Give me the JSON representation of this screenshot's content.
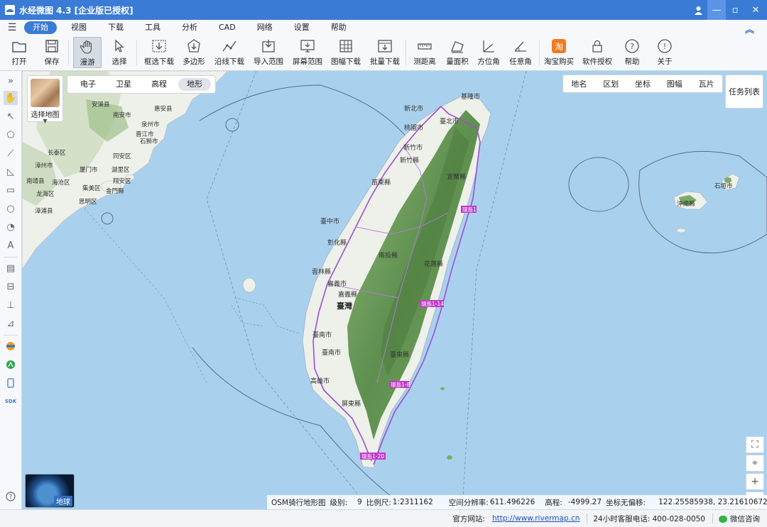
{
  "window": {
    "title": "水经微图 4.3 [企业版已授权]"
  },
  "menu": {
    "items": [
      "开始",
      "视图",
      "下载",
      "工具",
      "分析",
      "CAD",
      "网络",
      "设置",
      "帮助"
    ],
    "active": "开始"
  },
  "toolbar": {
    "items": [
      {
        "label": "打开",
        "icon": "folder-icon"
      },
      {
        "label": "保存",
        "icon": "save-icon"
      },
      {
        "label": "漫游",
        "icon": "hand-icon"
      },
      {
        "label": "选择",
        "icon": "cursor-icon"
      },
      {
        "label": "框选下载",
        "icon": "rect-download-icon"
      },
      {
        "label": "多边形",
        "icon": "polygon-download-icon"
      },
      {
        "label": "沿线下载",
        "icon": "line-download-icon"
      },
      {
        "label": "导入范围",
        "icon": "import-range-icon"
      },
      {
        "label": "屏幕范围",
        "icon": "screen-range-icon"
      },
      {
        "label": "图幅下载",
        "icon": "sheet-download-icon"
      },
      {
        "label": "批量下载",
        "icon": "batch-download-icon"
      },
      {
        "label": "测距离",
        "icon": "ruler-icon"
      },
      {
        "label": "量面积",
        "icon": "area-icon"
      },
      {
        "label": "方位角",
        "icon": "azimuth-icon"
      },
      {
        "label": "任意角",
        "icon": "angle-icon"
      },
      {
        "label": "淘宝购买",
        "icon": "taobao-icon"
      },
      {
        "label": "软件授权",
        "icon": "lock-icon"
      },
      {
        "label": "帮助",
        "icon": "help-icon"
      },
      {
        "label": "关于",
        "icon": "info-icon"
      }
    ]
  },
  "map": {
    "select_map_label": "选择地图",
    "map_types": [
      "电子",
      "卫星",
      "高程",
      "地形"
    ],
    "active_map_type": "地形",
    "layers": [
      "地名",
      "区划",
      "坐标",
      "图幅",
      "瓦片"
    ],
    "task_list_label": "任务列表",
    "earth_label": "地球",
    "labels": {
      "cities": [
        "新北市",
        "臺北市",
        "基隆市",
        "桃園市",
        "新竹市",
        "新竹縣",
        "苗栗縣",
        "宜蘭縣",
        "臺中市",
        "彰化縣",
        "南投縣",
        "花蓮縣",
        "雲林縣",
        "嘉義市",
        "嘉義縣",
        "臺灣",
        "臺南市",
        "臺南市",
        "高雄市",
        "屏東縣",
        "臺東縣"
      ],
      "mainland": [
        "安溪县",
        "南安市",
        "泉州市",
        "晋江市",
        "石狮市",
        "漳州市",
        "长泰区",
        "厦门市",
        "海沧区",
        "集美区",
        "翔安区",
        "龙海区",
        "金門縣",
        "湖里区",
        "思明区",
        "漳浦县",
        "同安区",
        "南靖县",
        "惠安县"
      ],
      "others": [
        "沖繩縣",
        "石垣市",
        "環島1-14",
        "環島1-8",
        "環島1-20",
        "環島1"
      ]
    }
  },
  "infobar": {
    "map_name": "OSM骑行地形图",
    "level_label": "级别:",
    "level": "9",
    "scale_label": "比例尺:",
    "scale": "1:2311162",
    "resolution_label": "空间分辨率:",
    "resolution": "611.496226",
    "elevation_label": "高程:",
    "elevation": "-4999.27",
    "coord_label": "坐标无偏移:",
    "coord": "122.25585938, 23.21610672"
  },
  "statusbar": {
    "site_label": "官方网站:",
    "site_url": "http://www.rivermap.cn",
    "hotline": "24小时客服电话: 400-028-0050",
    "wechat": "微信咨询"
  },
  "colors": {
    "accent": "#3a7bd5",
    "sea": "#a9d1ee",
    "land_mainland": "#eef0ea",
    "forest": "#7faa6b",
    "road": "#9b4fd6"
  }
}
